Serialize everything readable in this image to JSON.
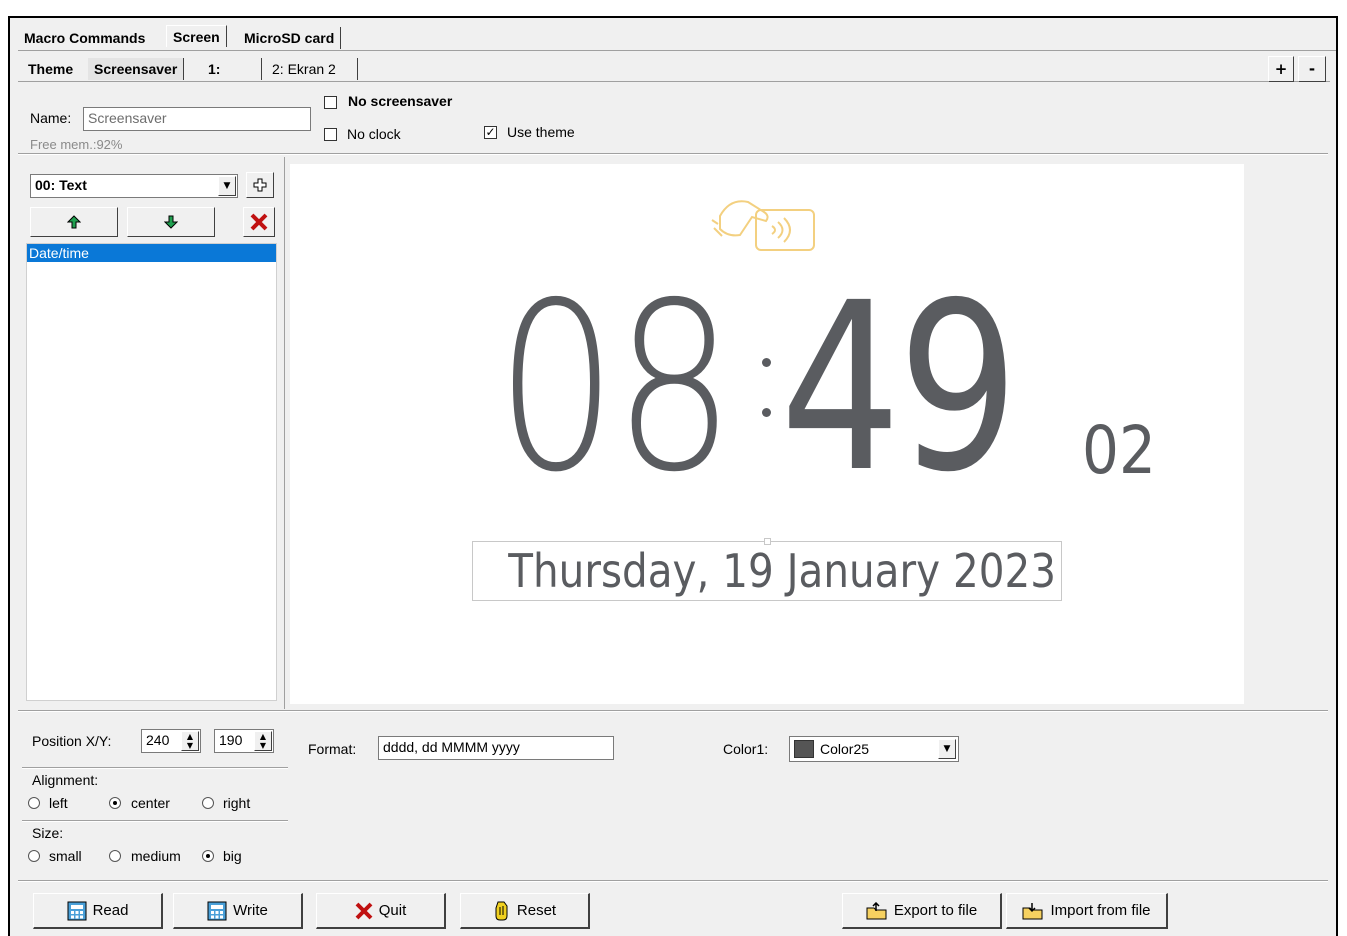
{
  "tabs_main": [
    "Macro Commands",
    "Screen",
    "MicroSD card"
  ],
  "tabs_sub": [
    "Theme",
    "Screensaver",
    "1:",
    "2: Ekran 2"
  ],
  "plus_label": "+",
  "minus_label": "-",
  "name_label": "Name:",
  "name_value": "Screensaver",
  "free_mem": "Free mem.:92%",
  "no_screensaver_label": "No screensaver",
  "no_clock_label": "No clock",
  "use_theme_label": "Use theme",
  "use_theme_checked": true,
  "element_select": "00: Text",
  "element_list": [
    "Date/time"
  ],
  "preview": {
    "hours": "08",
    "minutes": "49",
    "seconds": "02",
    "date": "Thursday, 19 January 2023",
    "clock_color": "#5a5c60",
    "card_icon_color": "#f3d080"
  },
  "position_label": "Position X/Y:",
  "pos_x": "240",
  "pos_y": "190",
  "format_label": "Format:",
  "format_value": "dddd, dd MMMM yyyy",
  "color_label": "Color1:",
  "color_value": "Color25",
  "color_swatch": "#555555",
  "alignment_label": "Alignment:",
  "alignment_options": [
    "left",
    "center",
    "right"
  ],
  "alignment_selected": "center",
  "size_label": "Size:",
  "size_options": [
    "small",
    "medium",
    "big"
  ],
  "size_selected": "big",
  "buttons": {
    "read": "Read",
    "write": "Write",
    "quit": "Quit",
    "reset": "Reset",
    "export": "Export to file",
    "import": "Import from file"
  }
}
